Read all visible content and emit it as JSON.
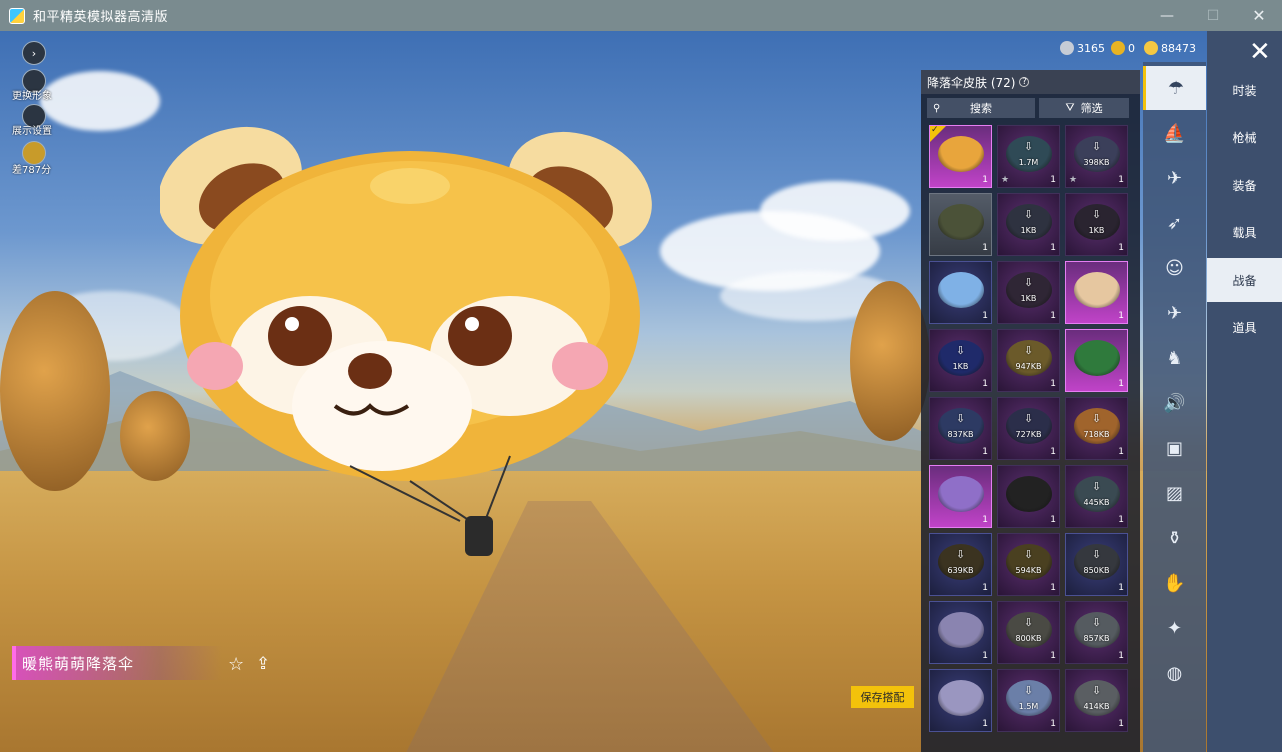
{
  "window": {
    "title": "和平精英模拟器高清版",
    "minimize_glyph": "—",
    "maximize_glyph": "☐",
    "close_glyph": "✕"
  },
  "left_menu": {
    "expand_glyph": "›",
    "items": [
      {
        "label": "更换形象",
        "icon": "person-icon"
      },
      {
        "label": "展示设置",
        "icon": "eye-icon"
      },
      {
        "label": "差787分",
        "icon": "rank-badge-icon"
      }
    ]
  },
  "currency": {
    "items": [
      {
        "value": "3165",
        "icon": "silver-coin-icon",
        "color": "#c6ccd6"
      },
      {
        "value": "0",
        "icon": "gold-token-icon",
        "color": "#e8b323"
      },
      {
        "value": "88473",
        "icon": "gold-coin-icon",
        "color": "#f5c842"
      }
    ]
  },
  "panel": {
    "title": "降落伞皮肤 (72)",
    "help_glyph": "?",
    "search_label": "搜索",
    "search_icon": "search-icon",
    "filter_label": "筛选",
    "filter_icon": "filter-icon",
    "items": [
      {
        "style": "pink",
        "selected": true,
        "disc": "#e8a53c",
        "download": false,
        "size": "",
        "count": "1",
        "star": false
      },
      {
        "style": "purple",
        "disc": "#2f4a56",
        "download": true,
        "size": "1.7M",
        "count": "1",
        "star": true
      },
      {
        "style": "purple",
        "disc": "#3b3f5a",
        "download": true,
        "size": "398KB",
        "count": "1",
        "star": true
      },
      {
        "style": "gray",
        "disc": "#4b5238",
        "download": false,
        "size": "",
        "count": "1",
        "star": false
      },
      {
        "style": "purple",
        "disc": "#2e3240",
        "download": true,
        "size": "1KB",
        "count": "1",
        "star": false
      },
      {
        "style": "purple",
        "disc": "#2a2430",
        "download": true,
        "size": "1KB",
        "count": "1",
        "star": false
      },
      {
        "style": "blue",
        "disc": "#7fb1e6",
        "download": false,
        "size": "",
        "count": "1",
        "star": false
      },
      {
        "style": "purple",
        "disc": "#2f2635",
        "download": true,
        "size": "1KB",
        "count": "1",
        "star": false
      },
      {
        "style": "pink",
        "disc": "#e6c7a0",
        "download": false,
        "size": "",
        "count": "1",
        "star": false
      },
      {
        "style": "purple",
        "disc": "#1f2a6a",
        "download": true,
        "size": "1KB",
        "count": "1",
        "star": false
      },
      {
        "style": "purple",
        "disc": "#6b5a2a",
        "download": true,
        "size": "947KB",
        "count": "1",
        "star": false
      },
      {
        "style": "pink",
        "disc": "#2f7a3c",
        "download": false,
        "size": "",
        "count": "1",
        "star": false
      },
      {
        "style": "purple",
        "disc": "#2d3a63",
        "download": true,
        "size": "837KB",
        "count": "1",
        "star": false
      },
      {
        "style": "purple",
        "disc": "#2b2e4a",
        "download": true,
        "size": "727KB",
        "count": "1",
        "star": false
      },
      {
        "style": "purple",
        "disc": "#a0642c",
        "download": true,
        "size": "718KB",
        "count": "1",
        "star": false
      },
      {
        "style": "pink",
        "disc": "#8f6fc8",
        "download": false,
        "size": "",
        "count": "1",
        "star": false
      },
      {
        "style": "purple",
        "disc": "#222222",
        "download": false,
        "size": "",
        "count": "1",
        "star": false
      },
      {
        "style": "purple",
        "disc": "#3a4a52",
        "download": true,
        "size": "445KB",
        "count": "1",
        "star": false
      },
      {
        "style": "blue",
        "disc": "#3b3320",
        "download": true,
        "size": "639KB",
        "count": "1",
        "star": false
      },
      {
        "style": "purple",
        "disc": "#4a4020",
        "download": true,
        "size": "594KB",
        "count": "1",
        "star": false
      },
      {
        "style": "blue",
        "disc": "#35383e",
        "download": true,
        "size": "850KB",
        "count": "1",
        "star": false
      },
      {
        "style": "blue",
        "disc": "#8a84b0",
        "download": false,
        "size": "",
        "count": "1",
        "star": false
      },
      {
        "style": "purple",
        "disc": "#4a4a44",
        "download": true,
        "size": "800KB",
        "count": "1",
        "star": false
      },
      {
        "style": "purple",
        "disc": "#555b60",
        "download": true,
        "size": "857KB",
        "count": "1",
        "star": false
      },
      {
        "style": "blue",
        "disc": "#9a96c0",
        "download": false,
        "size": "",
        "count": "1",
        "star": false
      },
      {
        "style": "purple",
        "disc": "#6b7fa8",
        "download": true,
        "size": "1.5M",
        "count": "1",
        "star": false
      },
      {
        "style": "purple",
        "disc": "#5a5e62",
        "download": true,
        "size": "414KB",
        "count": "1",
        "star": false
      }
    ]
  },
  "categories": [
    {
      "icon": "parachute-icon",
      "glyph": "☂",
      "active": true
    },
    {
      "icon": "boat-icon",
      "glyph": "⛵",
      "active": false
    },
    {
      "icon": "plane-icon",
      "glyph": "✈",
      "active": false
    },
    {
      "icon": "glider-icon",
      "glyph": "➶",
      "active": false
    },
    {
      "icon": "emote-face-icon",
      "glyph": "☺",
      "active": false
    },
    {
      "icon": "jet-icon",
      "glyph": "✈",
      "active": false
    },
    {
      "icon": "pet-icon",
      "glyph": "♞",
      "active": false
    },
    {
      "icon": "speaker-icon",
      "glyph": "🔊",
      "active": false
    },
    {
      "icon": "card-icon",
      "glyph": "▣",
      "active": false
    },
    {
      "icon": "picture-icon",
      "glyph": "▨",
      "active": false
    },
    {
      "icon": "extinguisher-icon",
      "glyph": "⚱",
      "active": false
    },
    {
      "icon": "hand-icon",
      "glyph": "✋",
      "active": false
    },
    {
      "icon": "wand-icon",
      "glyph": "✦",
      "active": false
    },
    {
      "icon": "ufo-icon",
      "glyph": "◍",
      "active": false
    }
  ],
  "tabs": [
    {
      "label": "时装",
      "active": false
    },
    {
      "label": "枪械",
      "active": false
    },
    {
      "label": "装备",
      "active": false
    },
    {
      "label": "载具",
      "active": false
    },
    {
      "label": "战备",
      "active": true
    },
    {
      "label": "道具",
      "active": false
    }
  ],
  "close_glyph": "✕",
  "item_name": "暖熊萌萌降落伞",
  "favorite_glyph": "☆",
  "share_glyph": "⇪",
  "save_label": "保存搭配",
  "colors": {
    "accent_yellow": "#f3c20b",
    "rarity_pink": "#da4cc7"
  }
}
